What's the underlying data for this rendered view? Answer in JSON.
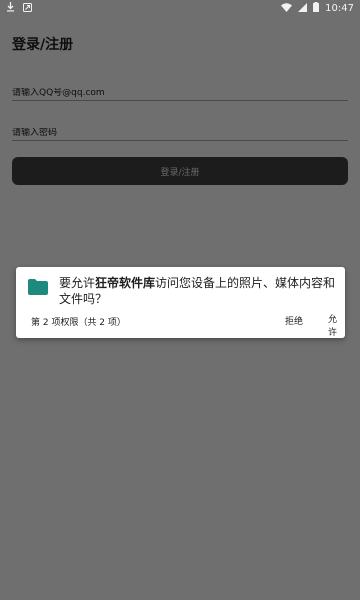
{
  "status_bar": {
    "time": "10:47",
    "left_icons": [
      "download-icon",
      "app-notification-icon"
    ],
    "right_icons": [
      "wifi-icon",
      "signal-icon",
      "battery-icon"
    ]
  },
  "login": {
    "title": "登录/注册",
    "account_placeholder": "请输入QQ号@qq.com",
    "password_placeholder": "请输入密码",
    "submit_label": "登录/注册"
  },
  "permission_dialog": {
    "message_prefix": "要允许",
    "app_name": "狂帝软件库",
    "message_suffix": "访问您设备上的照片、媒体内容和文件吗？",
    "count_text": "第 2 项权限（共 2 项）",
    "deny_label": "拒绝",
    "allow_label": "允许",
    "icon": "folder-icon",
    "icon_color": "#1e8a7e"
  }
}
